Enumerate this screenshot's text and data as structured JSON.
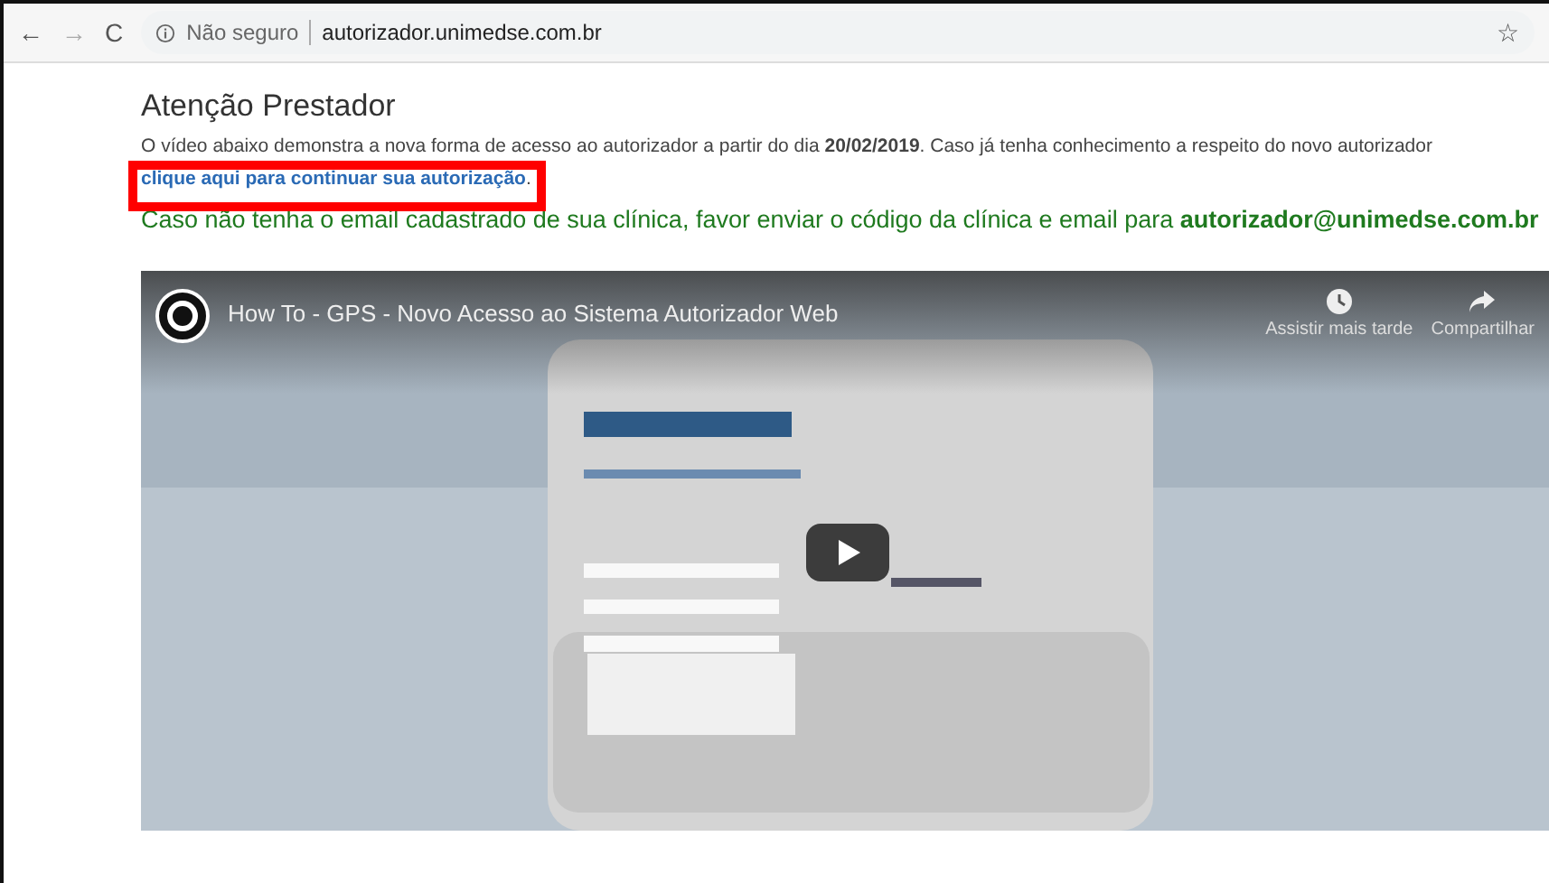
{
  "browser": {
    "back": "←",
    "forward": "→",
    "reload": "C",
    "security_label": "Não seguro",
    "url": "autorizador.unimedse.com.br",
    "star": "☆"
  },
  "page": {
    "title": "Atenção Prestador",
    "intro": "O vídeo abaixo demonstra a nova forma de acesso ao autorizador a partir do dia **20/02/2019**. Caso já tenha conhecimento a respeito do novo autorizador",
    "link": "clique aqui para continuar sua autorização",
    "link_suffix": ".",
    "notice": "Caso não tenha o email cadastrado de sua clínica, favor enviar o código da clínica e email para **autorizador@unimedse.com.br**"
  },
  "video": {
    "title": "How To - GPS - Novo Acesso ao Sistema Autorizador Web",
    "actions": [
      {
        "kind": "clock",
        "label": "Assistir mais tarde"
      },
      {
        "kind": "share",
        "label": "Compartilhar"
      }
    ]
  }
}
